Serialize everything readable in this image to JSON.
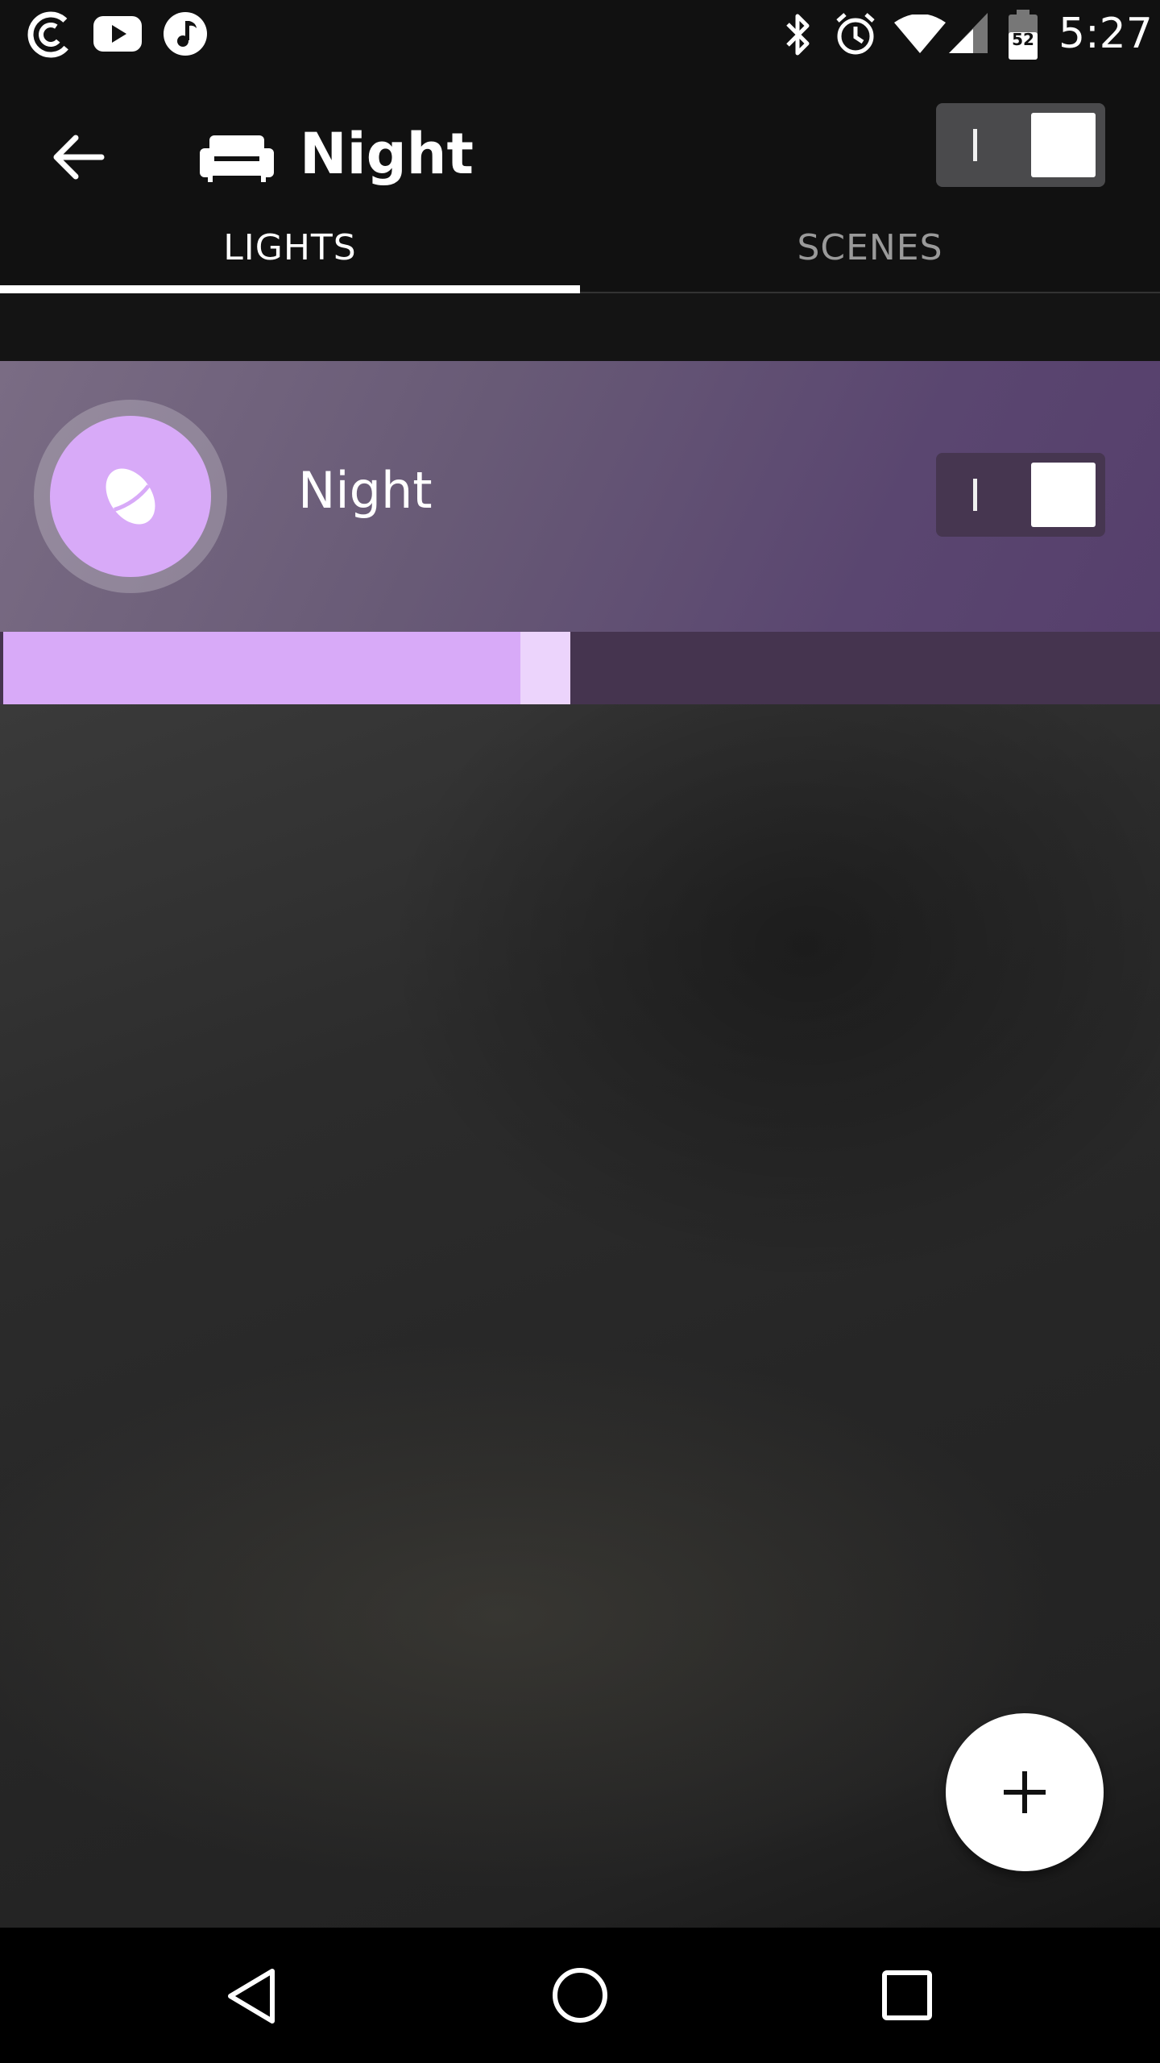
{
  "status_bar": {
    "time": "5:27",
    "battery_level": "52",
    "icons": [
      "pocket-casts-icon",
      "youtube-icon",
      "music-icon",
      "bluetooth-icon",
      "alarm-icon",
      "wifi-icon",
      "cell-signal-icon",
      "battery-icon"
    ]
  },
  "app_bar": {
    "title": "Night",
    "room_icon": "sofa-icon",
    "group_toggle": {
      "mark": "I",
      "state": "on"
    }
  },
  "tabs": [
    {
      "label": "LIGHTS",
      "selected": true
    },
    {
      "label": "SCENES",
      "selected": false
    }
  ],
  "lights": [
    {
      "name": "Night",
      "color": "#d8aaf8",
      "toggle": {
        "mark": "I",
        "state": "on"
      },
      "brightness": 0.45
    }
  ],
  "fab": {
    "icon": "plus-icon"
  },
  "nav_bar": {
    "icons": [
      "back-triangle-icon",
      "home-circle-icon",
      "recents-square-icon"
    ]
  },
  "colors": {
    "accent": "#d8aaf8",
    "light_row": "#5e4a72",
    "slider_track": "#45344f",
    "bar_background": "#111111"
  }
}
